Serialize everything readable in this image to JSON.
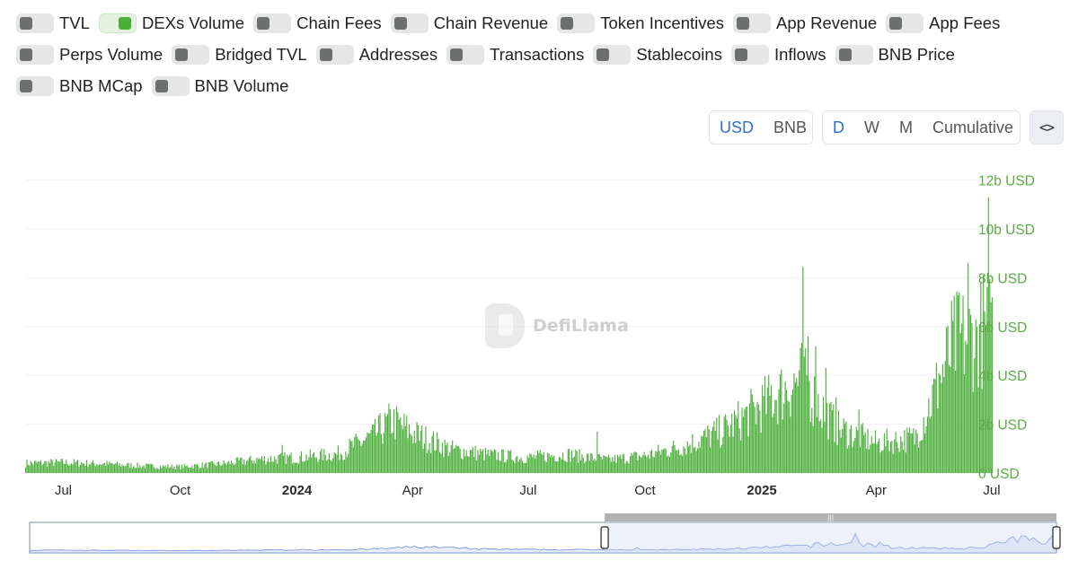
{
  "toggles": [
    {
      "label": "TVL",
      "on": false
    },
    {
      "label": "DEXs Volume",
      "on": true
    },
    {
      "label": "Chain Fees",
      "on": false
    },
    {
      "label": "Chain Revenue",
      "on": false
    },
    {
      "label": "Token Incentives",
      "on": false
    },
    {
      "label": "App Revenue",
      "on": false
    },
    {
      "label": "App Fees",
      "on": false
    },
    {
      "label": "Perps Volume",
      "on": false
    },
    {
      "label": "Bridged TVL",
      "on": false
    },
    {
      "label": "Addresses",
      "on": false
    },
    {
      "label": "Transactions",
      "on": false
    },
    {
      "label": "Stablecoins",
      "on": false
    },
    {
      "label": "Inflows",
      "on": false
    },
    {
      "label": "BNB Price",
      "on": false
    },
    {
      "label": "BNB MCap",
      "on": false
    },
    {
      "label": "BNB Volume",
      "on": false
    }
  ],
  "currency": {
    "options": [
      "USD",
      "BNB"
    ],
    "selected": "USD"
  },
  "period": {
    "options": [
      "D",
      "W",
      "M",
      "Cumulative"
    ],
    "selected": "D"
  },
  "embed_icon": "code-icon",
  "embed_glyph": "<>",
  "watermark": "DefiLlama",
  "colors": {
    "series": "#4caf3b",
    "axis_text": "#5aac43",
    "brush": "#6b8cd8",
    "accent": "#2f6fce"
  },
  "chart_data": {
    "type": "bar",
    "series": [
      {
        "name": "DEXs Volume",
        "unit": "USD",
        "note": "daily DEX volume; values in billions USD estimated from the axis"
      }
    ],
    "ylim": [
      0,
      12
    ],
    "y_ticks": [
      "0 USD",
      "2b USD",
      "4b USD",
      "6b USD",
      "8b USD",
      "10b USD",
      "12b USD"
    ],
    "x_ticks": [
      "Jul",
      "Oct",
      "2024",
      "Apr",
      "Jul",
      "Oct",
      "2025",
      "Apr",
      "Jul"
    ],
    "x_ticks_bold": [
      "2024",
      "2025"
    ],
    "x_range": [
      "2023-06-01",
      "2025-07-01"
    ],
    "keypoints": [
      [
        "2023-06-01",
        0.4
      ],
      [
        "2023-07-01",
        0.42
      ],
      [
        "2023-08-01",
        0.37
      ],
      [
        "2023-09-01",
        0.28
      ],
      [
        "2023-10-01",
        0.25
      ],
      [
        "2023-11-01",
        0.36
      ],
      [
        "2023-12-01",
        0.55
      ],
      [
        "2024-01-01",
        0.62
      ],
      [
        "2024-02-01",
        0.75
      ],
      [
        "2024-03-01",
        1.5
      ],
      [
        "2024-03-15",
        2.1
      ],
      [
        "2024-04-01",
        1.6
      ],
      [
        "2024-05-01",
        0.95
      ],
      [
        "2024-06-01",
        0.72
      ],
      [
        "2024-07-01",
        0.62
      ],
      [
        "2024-08-01",
        0.75
      ],
      [
        "2024-09-01",
        0.52
      ],
      [
        "2024-10-01",
        0.7
      ],
      [
        "2024-11-01",
        1.1
      ],
      [
        "2024-12-01",
        1.7
      ],
      [
        "2025-01-01",
        2.7
      ],
      [
        "2025-02-01",
        3.8
      ],
      [
        "2025-02-15",
        2.7
      ],
      [
        "2025-03-01",
        1.8
      ],
      [
        "2025-04-01",
        1.2
      ],
      [
        "2025-05-01",
        1.4
      ],
      [
        "2025-05-15",
        3.0
      ],
      [
        "2025-06-01",
        5.2
      ],
      [
        "2025-07-01",
        5.8
      ]
    ],
    "spikes": [
      [
        "2023-12-20",
        1.15
      ],
      [
        "2024-03-10",
        2.45
      ],
      [
        "2024-08-24",
        1.7
      ],
      [
        "2024-11-20",
        1.8
      ],
      [
        "2024-12-18",
        2.6
      ],
      [
        "2025-01-08",
        3.6
      ],
      [
        "2025-01-20",
        3.4
      ],
      [
        "2025-02-02",
        8.45
      ],
      [
        "2025-02-06",
        5.6
      ],
      [
        "2025-02-12",
        5.2
      ],
      [
        "2025-02-20",
        4.3
      ],
      [
        "2025-02-28",
        3.1
      ],
      [
        "2025-03-18",
        2.6
      ],
      [
        "2025-05-20",
        4.1
      ],
      [
        "2025-06-05",
        7.4
      ],
      [
        "2025-06-12",
        8.6
      ],
      [
        "2025-06-18",
        6.3
      ],
      [
        "2025-06-24",
        8.1
      ],
      [
        "2025-06-28",
        11.3
      ],
      [
        "2025-06-30",
        7.0
      ]
    ],
    "brush": {
      "start": "2023-06-01",
      "end": "2025-07-01",
      "window_fraction": [
        0.56,
        1.0
      ]
    }
  }
}
